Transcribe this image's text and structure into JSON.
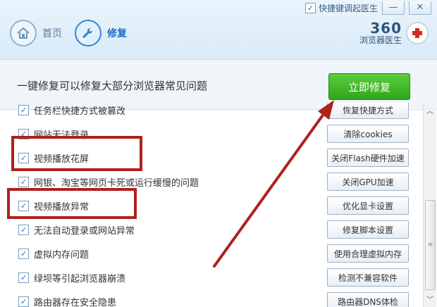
{
  "window": {
    "hotkey_label": "快捷键调起医生",
    "minimize": "—",
    "close": "✕"
  },
  "nav": {
    "home": "首页",
    "repair": "修复"
  },
  "brand": {
    "name": "360",
    "sub": "浏览器医生"
  },
  "bar": {
    "text": "一键修复可以修复大部分浏览器常见问题",
    "fix_button": "立即修复"
  },
  "items": [
    {
      "label": "任务栏快捷方式被篡改",
      "action": "恢复快捷方式"
    },
    {
      "label": "网站无法登录",
      "action": "清除cookies"
    },
    {
      "label": "视频播放花屏",
      "action": "关闭Flash硬件加速"
    },
    {
      "label": "网银、淘宝等网页卡死或运行缓慢的问题",
      "action": "关闭GPU加速"
    },
    {
      "label": "视频播放异常",
      "action": "优化显卡设置"
    },
    {
      "label": "无法自动登录或网站异常",
      "action": "修复脚本设置"
    },
    {
      "label": "虚拟内存问题",
      "action": "使用合理虚拟内存"
    },
    {
      "label": "绿坝等引起浏览器崩溃",
      "action": "检测不兼容软件"
    },
    {
      "label": "路由器存在安全隐患",
      "action": "路由器DNS体检"
    }
  ],
  "colors": {
    "accent": "#1f6fc9",
    "fix_green": "#2fa51b",
    "highlight_red": "#b0201c"
  },
  "icons": {
    "home": "home-icon",
    "repair": "wrench-icon",
    "brand": "red-cross-icon"
  }
}
